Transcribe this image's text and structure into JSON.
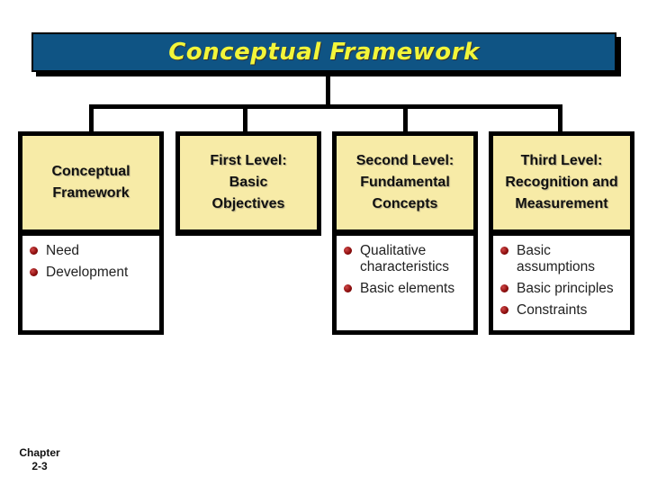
{
  "title": "Conceptual Framework",
  "colors": {
    "banner_bg": "#0f5484",
    "title_text": "#f2f53a",
    "box_fill": "#f7eba7",
    "bullet": "#8a0b0b"
  },
  "columns": [
    {
      "heading": "Conceptual\nFramework",
      "items": [
        "Need",
        "Development"
      ]
    },
    {
      "heading": "First Level:\nBasic\nObjectives",
      "items": []
    },
    {
      "heading": "Second Level:\nFundamental\nConcepts",
      "items": [
        "Qualitative characteristics",
        "Basic elements"
      ]
    },
    {
      "heading": "Third Level:\nRecognition and\nMeasurement",
      "items": [
        "Basic assumptions",
        "Basic principles",
        "Constraints"
      ]
    }
  ],
  "footer": "Chapter\n2-3"
}
